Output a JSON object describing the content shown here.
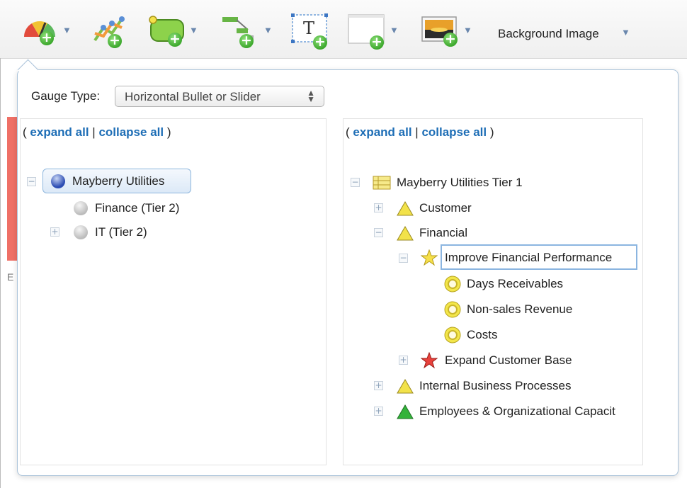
{
  "toolbar": {
    "items": [
      {
        "icon": "gauge-add-icon"
      },
      {
        "icon": "chart-add-icon"
      },
      {
        "icon": "shape-add-icon"
      },
      {
        "icon": "connector-add-icon"
      },
      {
        "icon": "text-add-icon",
        "glyph": "T"
      },
      {
        "icon": "box-add-icon"
      },
      {
        "icon": "image-add-icon"
      }
    ],
    "background_image_label": "Background Image"
  },
  "gauge_type": {
    "label": "Gauge Type:",
    "selected": "Horizontal Bullet or Slider"
  },
  "left_tree": {
    "expand_all": "expand all",
    "collapse_all": "collapse all",
    "open_paren": "(",
    "separator": "|",
    "close_paren": ")",
    "nodes": [
      {
        "label": "Mayberry Utilities"
      },
      {
        "label": "Finance (Tier 2)"
      },
      {
        "label": "IT (Tier 2)"
      }
    ]
  },
  "right_tree": {
    "expand_all": "expand all",
    "collapse_all": "collapse all",
    "open_paren": "(",
    "separator": "|",
    "close_paren": ")",
    "nodes": [
      {
        "label": "Mayberry Utilities Tier 1"
      },
      {
        "label": "Customer"
      },
      {
        "label": "Financial"
      },
      {
        "label": "Improve Financial Performance"
      },
      {
        "label": "Days Receivables"
      },
      {
        "label": "Non-sales Revenue"
      },
      {
        "label": "Costs"
      },
      {
        "label": "Expand Customer Base"
      },
      {
        "label": "Internal Business Processes"
      },
      {
        "label": "Employees & Organizational Capacit"
      }
    ]
  },
  "side_strip_letter": "E",
  "colors": {
    "link": "#1e6eb6",
    "selection_border": "#8bb5e0",
    "warning_yellow": "#f2e24a",
    "ok_green": "#33b33a",
    "star_red": "#e8413c",
    "strip_red": "#ef7066"
  }
}
